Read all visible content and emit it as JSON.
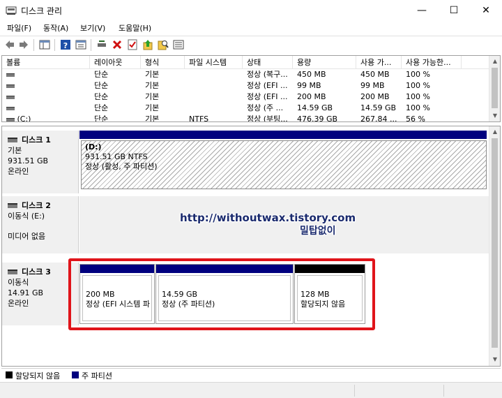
{
  "window": {
    "title": "디스크 관리",
    "minimize_glyph": "—",
    "maximize_glyph": "☐",
    "close_glyph": "✕"
  },
  "menu": [
    "파일(F)",
    "동작(A)",
    "보기(V)",
    "도움말(H)"
  ],
  "toolbar": [
    "back-icon",
    "forward-icon",
    "console-tree-icon",
    "help-icon",
    "properties-icon",
    "connect-icon",
    "delete-icon",
    "check-icon",
    "up-arrow-icon",
    "search-icon",
    "list-icon"
  ],
  "volume_list": {
    "columns": [
      "볼륨",
      "레이아웃",
      "형식",
      "파일 시스템",
      "상태",
      "용량",
      "사용 가...",
      "사용 가능한..."
    ],
    "rows": [
      {
        "volume": "",
        "layout": "단순",
        "type": "기본",
        "fs": "",
        "status": "정상 (복구...",
        "capacity": "450 MB",
        "free": "450 MB",
        "pct": "100 %"
      },
      {
        "volume": "",
        "layout": "단순",
        "type": "기본",
        "fs": "",
        "status": "정상 (EFI ...",
        "capacity": "99 MB",
        "free": "99 MB",
        "pct": "100 %"
      },
      {
        "volume": "",
        "layout": "단순",
        "type": "기본",
        "fs": "",
        "status": "정상 (EFI ...",
        "capacity": "200 MB",
        "free": "200 MB",
        "pct": "100 %"
      },
      {
        "volume": "",
        "layout": "단순",
        "type": "기본",
        "fs": "",
        "status": "정상 (주 ...",
        "capacity": "14.59 GB",
        "free": "14.59 GB",
        "pct": "100 %"
      },
      {
        "volume": "(C:)",
        "layout": "단순",
        "type": "기본",
        "fs": "NTFS",
        "status": "정상 (부팅...",
        "capacity": "476.39 GB",
        "free": "267.84 ...",
        "pct": "56 %"
      }
    ]
  },
  "disks": {
    "disk1": {
      "name": "디스크 1",
      "type": "기본",
      "size": "931.51 GB",
      "status": "온라인",
      "partition": {
        "label": "(D:)",
        "size": "931.51 GB NTFS",
        "status": "정상 (활성, 주 파티션)"
      }
    },
    "disk2": {
      "name": "디스크 2",
      "type": "이동식 (E:)",
      "media": "미디어 없음"
    },
    "disk3": {
      "name": "디스크 3",
      "type": "이동식",
      "size": "14.91 GB",
      "status": "온라인",
      "partitions": [
        {
          "size": "200 MB",
          "status": "정상 (EFI 시스템 파"
        },
        {
          "size": "14.59 GB",
          "status": "정상 (주 파티션)"
        },
        {
          "size": "128 MB",
          "status": "할당되지 않음"
        }
      ]
    }
  },
  "watermark": {
    "line1": "http://withoutwax.tistory.com",
    "line2": "밀탑없이"
  },
  "legend": {
    "unallocated": "할당되지 않음",
    "primary": "주 파티션"
  },
  "colors": {
    "primary_partition": "#00007f",
    "unallocated": "#000000",
    "highlight": "#e0141a"
  }
}
